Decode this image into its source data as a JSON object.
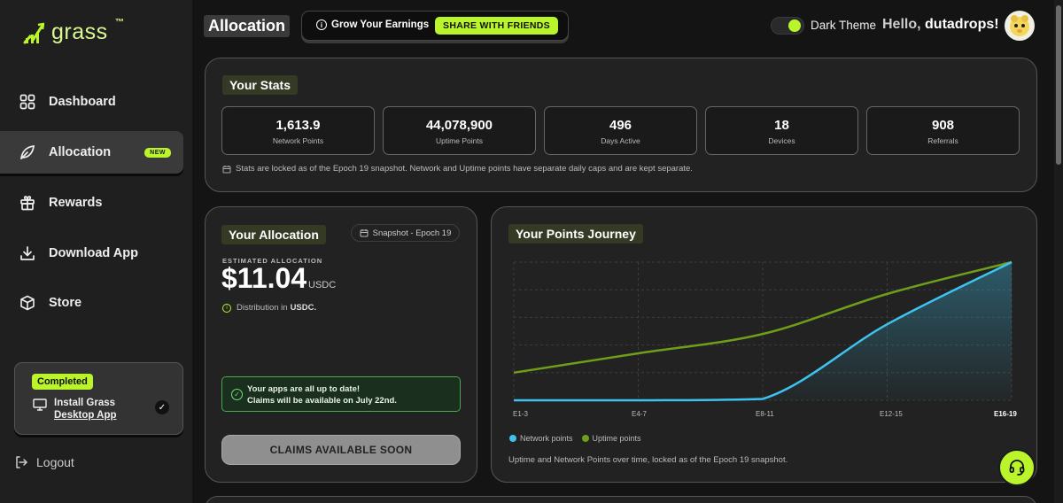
{
  "brand": {
    "name": "grass",
    "tm": "™"
  },
  "sidebar": {
    "items": [
      {
        "label": "Dashboard",
        "icon": "grid-icon"
      },
      {
        "label": "Allocation",
        "icon": "leaf-icon",
        "badge": "NEW",
        "active": true
      },
      {
        "label": "Rewards",
        "icon": "gift-icon"
      },
      {
        "label": "Download App",
        "icon": "download-icon"
      },
      {
        "label": "Store",
        "icon": "cube-icon"
      }
    ],
    "install_card": {
      "status": "Completed",
      "title": "Install Grass",
      "subtitle": "Desktop App"
    },
    "logout": "Logout"
  },
  "header": {
    "title": "Allocation",
    "promo": {
      "label": "Grow Your Earnings",
      "button": "SHARE WITH FRIENDS"
    },
    "theme_label": "Dark Theme",
    "dark_theme_on": true,
    "greeting": "Hello,",
    "username": "dutadrops!"
  },
  "stats": {
    "title": "Your Stats",
    "items": [
      {
        "value": "1,613.9",
        "label": "Network Points"
      },
      {
        "value": "44,078,900",
        "label": "Uptime Points"
      },
      {
        "value": "496",
        "label": "Days Active"
      },
      {
        "value": "18",
        "label": "Devices"
      },
      {
        "value": "908",
        "label": "Referrals"
      }
    ],
    "note": "Stats are locked as of the Epoch 19 snapshot. Network and Uptime points have separate daily caps and are kept separate."
  },
  "allocation": {
    "title": "Your Allocation",
    "snapshot": "Snapshot - Epoch 19",
    "estimated_label": "ESTIMATED ALLOCATION",
    "amount": "$11.04",
    "unit": "USDC",
    "distribution_prefix": "Distribution in",
    "distribution_currency": "USDC.",
    "update_line1": "Your apps are all up to date!",
    "update_line2": "Claims will be available on July 22nd.",
    "claims_button": "CLAIMS AVAILABLE SOON"
  },
  "journey": {
    "title": "Your Points Journey",
    "caption": "Uptime and Network Points over time, locked as of the Epoch 19 snapshot.",
    "colors": {
      "network": "#3ec3ef",
      "uptime": "#6f9f1a"
    }
  },
  "chart_data": {
    "type": "line",
    "categories": [
      "E1-3",
      "E4-7",
      "E8-11",
      "E12-15",
      "E16-19"
    ],
    "series": [
      {
        "name": "Network points",
        "values": [
          0.0,
          0.0,
          0.01,
          0.55,
          1.0
        ]
      },
      {
        "name": "Uptime points",
        "values": [
          0.2,
          0.34,
          0.48,
          0.77,
          1.0
        ]
      }
    ],
    "grid": true,
    "legend": "bottom-left"
  }
}
